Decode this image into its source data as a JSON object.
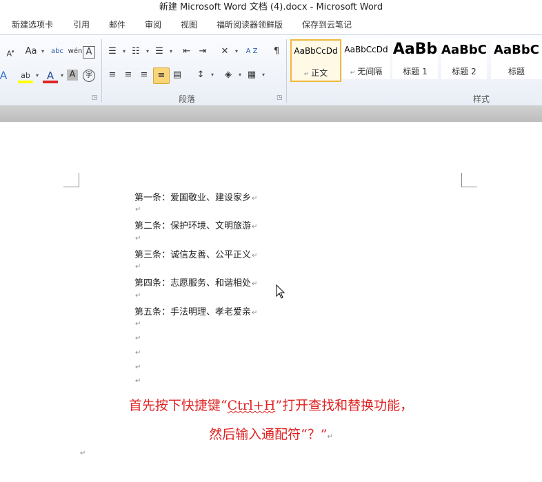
{
  "title_bar": {
    "title": "新建 Microsoft Word 文档 (4).docx  -  Microsoft Word"
  },
  "menu": {
    "tabs": [
      "新建选项卡",
      "引用",
      "邮件",
      "审阅",
      "视图",
      "福昕阅读器领鲜版",
      "保存到云笔记"
    ]
  },
  "ribbon": {
    "font_row1": [
      "A",
      "Aa",
      "abc",
      "wén",
      "A"
    ],
    "font_row2": [
      "A",
      "ab",
      "A",
      "A",
      "字"
    ],
    "paragraph_group_label": "段落",
    "styles_group_label": "样式",
    "styles": [
      {
        "sample": "AaBbCcDd",
        "name": "正文",
        "selected": true
      },
      {
        "sample": "AaBbCcDd",
        "name": "无间隔",
        "selected": false
      },
      {
        "sample": "AaBb",
        "name": "标题 1",
        "selected": false
      },
      {
        "sample": "AaBbC",
        "name": "标题 2",
        "selected": false
      },
      {
        "sample": "AaBbC",
        "name": "标题",
        "selected": false
      }
    ],
    "sort_label": "A Z"
  },
  "document": {
    "paragraph_mark": "↵",
    "lines": [
      "第一条：爱国敬业、建设家乡",
      "第二条：保护环境、文明旅游",
      "第三条：诚信友善、公平正义",
      "第四条：志愿服务、和谐相处",
      "第五条：手法明理、孝老爱亲"
    ],
    "annotation": {
      "line1_prefix": "首先按下快捷键“",
      "line1_shortcut": "Ctrl+H",
      "line1_suffix": "”打开查找和替换功能，",
      "line2": "然后输入通配符“？”"
    }
  },
  "colors": {
    "annotation_red": "#e02424",
    "selected_style_border": "#f0b840",
    "highlight_yellow": "#ffff00",
    "font_color_red": "#e02424"
  }
}
